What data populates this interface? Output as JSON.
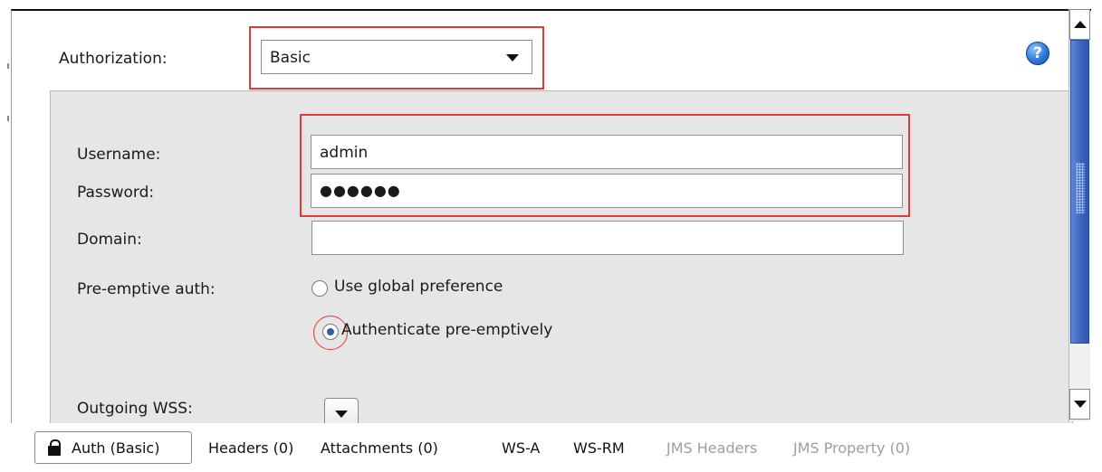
{
  "authorization": {
    "label": "Authorization:",
    "selected": "Basic"
  },
  "credentials": {
    "username_label": "Username:",
    "username_value": "admin",
    "password_label": "Password:",
    "password_masked": "●●●●●●",
    "domain_label": "Domain:",
    "domain_value": ""
  },
  "preemptive": {
    "label": "Pre-emptive auth:",
    "options": [
      {
        "label": "Use global preference",
        "selected": false
      },
      {
        "label": "Authenticate pre-emptively",
        "selected": true
      }
    ]
  },
  "outgoing_wss": {
    "label": "Outgoing WSS:"
  },
  "help_icon": {
    "symbol": "?",
    "color": "#2f78d8"
  },
  "tabs": [
    {
      "label": "Auth (Basic)",
      "active": true,
      "enabled": true
    },
    {
      "label": "Headers (0)",
      "active": false,
      "enabled": true
    },
    {
      "label": "Attachments (0)",
      "active": false,
      "enabled": true
    },
    {
      "label": "WS-A",
      "active": false,
      "enabled": true
    },
    {
      "label": "WS-RM",
      "active": false,
      "enabled": true
    },
    {
      "label": "JMS Headers",
      "active": false,
      "enabled": false
    },
    {
      "label": "JMS Property (0)",
      "active": false,
      "enabled": false
    }
  ],
  "highlight_color": "#e53935"
}
